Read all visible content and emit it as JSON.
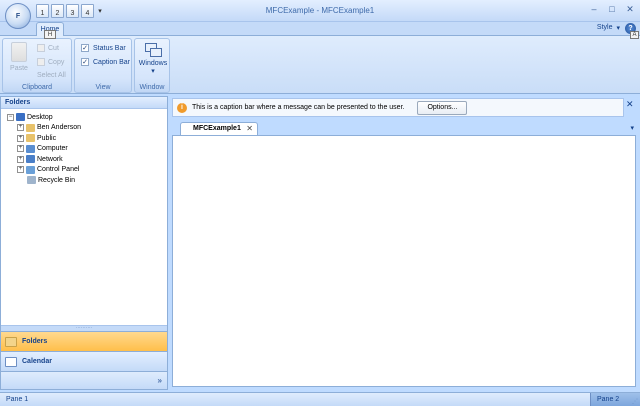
{
  "window": {
    "title": "MFCExample - MFCExample1",
    "orb_label": "F",
    "controls": [
      "–",
      "□",
      "✕"
    ]
  },
  "qat": {
    "buttons": [
      "1",
      "2",
      "3",
      "4"
    ],
    "dropdown": "▾"
  },
  "ribbon": {
    "tab_home": "Home",
    "keytip_home": "H",
    "style_label": "Style",
    "style_caret": "▾",
    "help_glyph": "?",
    "keytip_help": "A",
    "clipboard": {
      "paste": "Paste",
      "cut": "Cut",
      "copy": "Copy",
      "select_all": "Select All",
      "label": "Clipboard"
    },
    "view": {
      "status_bar": "Status Bar",
      "caption_bar": "Caption Bar",
      "check_glyph": "✓",
      "label": "View"
    },
    "window_group": {
      "windows": "Windows",
      "caret": "▾",
      "label": "Window"
    }
  },
  "folders_panel": {
    "title": "Folders",
    "tree": [
      {
        "label": "Desktop",
        "expander": "−",
        "indent": 0,
        "color": "#3a6fc4"
      },
      {
        "label": "Ben Anderson",
        "expander": "+",
        "indent": 1,
        "color": "#e8c26a"
      },
      {
        "label": "Public",
        "expander": "+",
        "indent": 1,
        "color": "#e8c26a"
      },
      {
        "label": "Computer",
        "expander": "+",
        "indent": 1,
        "color": "#5a8ed0"
      },
      {
        "label": "Network",
        "expander": "+",
        "indent": 1,
        "color": "#4a7fc8"
      },
      {
        "label": "Control Panel",
        "expander": "+",
        "indent": 1,
        "color": "#6aa0d8"
      },
      {
        "label": "Recycle Bin",
        "expander": "",
        "indent": 1,
        "color": "#9fb4cc"
      }
    ],
    "splitter_grip": "··········",
    "nav_folders": "Folders",
    "nav_calendar": "Calendar",
    "chevrons": "»"
  },
  "caption_bar": {
    "info_glyph": "i",
    "message": "This is a caption bar where a message can be presented to the user.",
    "options": "Options...",
    "close": "✕"
  },
  "document": {
    "tab": "MFCExample1",
    "tab_close": "✕",
    "tab_list": "▾"
  },
  "statusbar": {
    "pane1": "Pane 1",
    "pane2": "Pane 2",
    "grip": "⋰"
  },
  "colors": {
    "frame": "#bfdbff",
    "accent_nav": "#ffbf4a",
    "caption_info": "#f09b2c"
  }
}
